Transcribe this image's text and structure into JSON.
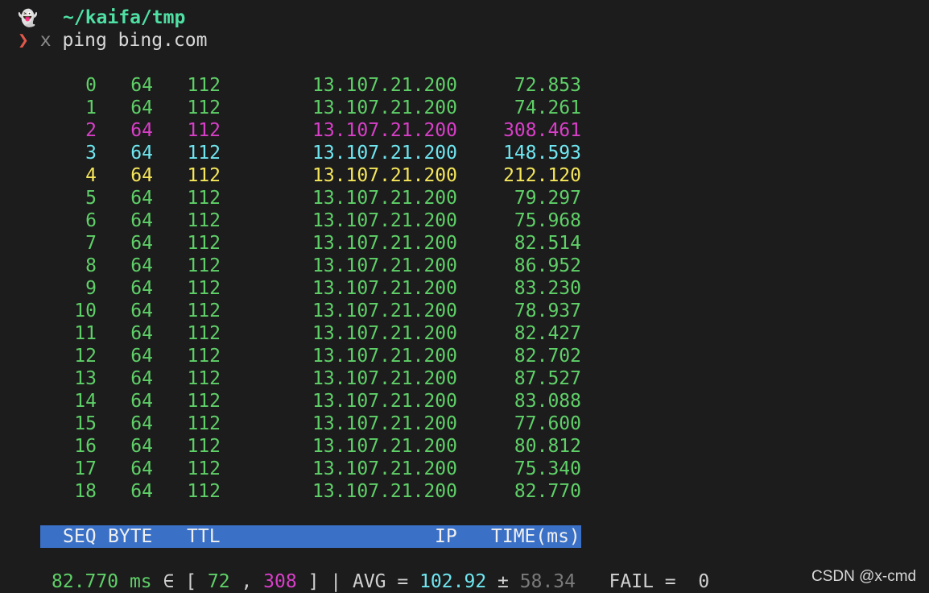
{
  "terminal": {
    "ghost_glyph": "👻",
    "cwd": "~/kaifa/tmp",
    "prompt_symbol": "❯",
    "prompt_marker": "x",
    "command": "ping bing.com"
  },
  "colors": {
    "normal": "#5fd068",
    "magenta": "#d83fc8",
    "cyan": "#6fe6f0",
    "yellow": "#f5e65a",
    "header_bg": "#3a70c6",
    "background": "#1c1c1c"
  },
  "table": {
    "headers": {
      "seq": "SEQ",
      "byte": "BYTE",
      "ttl": "TTL",
      "ip": "IP",
      "time": "TIME(ms)"
    },
    "rows": [
      {
        "seq": "0",
        "byte": "64",
        "ttl": "112",
        "ip": "13.107.21.200",
        "time": "72.853",
        "color": "normal"
      },
      {
        "seq": "1",
        "byte": "64",
        "ttl": "112",
        "ip": "13.107.21.200",
        "time": "74.261",
        "color": "normal"
      },
      {
        "seq": "2",
        "byte": "64",
        "ttl": "112",
        "ip": "13.107.21.200",
        "time": "308.461",
        "color": "magenta"
      },
      {
        "seq": "3",
        "byte": "64",
        "ttl": "112",
        "ip": "13.107.21.200",
        "time": "148.593",
        "color": "cyan"
      },
      {
        "seq": "4",
        "byte": "64",
        "ttl": "112",
        "ip": "13.107.21.200",
        "time": "212.120",
        "color": "yellow"
      },
      {
        "seq": "5",
        "byte": "64",
        "ttl": "112",
        "ip": "13.107.21.200",
        "time": "79.297",
        "color": "normal"
      },
      {
        "seq": "6",
        "byte": "64",
        "ttl": "112",
        "ip": "13.107.21.200",
        "time": "75.968",
        "color": "normal"
      },
      {
        "seq": "7",
        "byte": "64",
        "ttl": "112",
        "ip": "13.107.21.200",
        "time": "82.514",
        "color": "normal"
      },
      {
        "seq": "8",
        "byte": "64",
        "ttl": "112",
        "ip": "13.107.21.200",
        "time": "86.952",
        "color": "normal"
      },
      {
        "seq": "9",
        "byte": "64",
        "ttl": "112",
        "ip": "13.107.21.200",
        "time": "83.230",
        "color": "normal"
      },
      {
        "seq": "10",
        "byte": "64",
        "ttl": "112",
        "ip": "13.107.21.200",
        "time": "78.937",
        "color": "normal"
      },
      {
        "seq": "11",
        "byte": "64",
        "ttl": "112",
        "ip": "13.107.21.200",
        "time": "82.427",
        "color": "normal"
      },
      {
        "seq": "12",
        "byte": "64",
        "ttl": "112",
        "ip": "13.107.21.200",
        "time": "82.702",
        "color": "normal"
      },
      {
        "seq": "13",
        "byte": "64",
        "ttl": "112",
        "ip": "13.107.21.200",
        "time": "87.527",
        "color": "normal"
      },
      {
        "seq": "14",
        "byte": "64",
        "ttl": "112",
        "ip": "13.107.21.200",
        "time": "83.088",
        "color": "normal"
      },
      {
        "seq": "15",
        "byte": "64",
        "ttl": "112",
        "ip": "13.107.21.200",
        "time": "77.600",
        "color": "normal"
      },
      {
        "seq": "16",
        "byte": "64",
        "ttl": "112",
        "ip": "13.107.21.200",
        "time": "80.812",
        "color": "normal"
      },
      {
        "seq": "17",
        "byte": "64",
        "ttl": "112",
        "ip": "13.107.21.200",
        "time": "75.340",
        "color": "normal"
      },
      {
        "seq": "18",
        "byte": "64",
        "ttl": "112",
        "ip": "13.107.21.200",
        "time": "82.770",
        "color": "normal"
      }
    ]
  },
  "summary": {
    "last": "82.770",
    "unit": "ms",
    "in_symbol": "∈",
    "min": "72",
    "max": "308",
    "avg_label": "AVG =",
    "avg": "102.92",
    "pm": "±",
    "stddev": "58.34",
    "fail_label": "FAIL =",
    "fail": "0"
  },
  "watermark": "CSDN @x-cmd"
}
